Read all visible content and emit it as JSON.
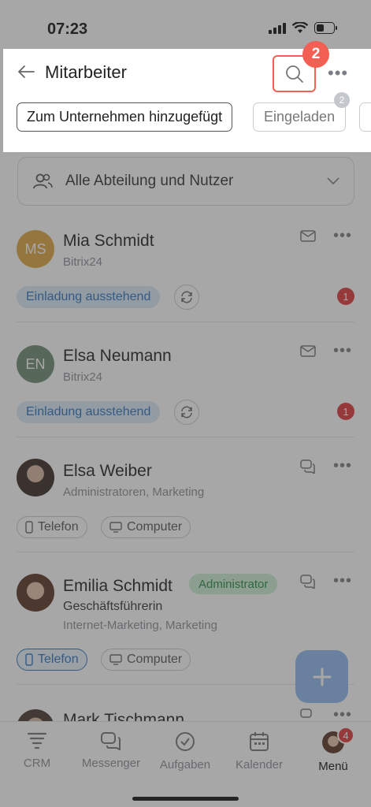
{
  "status": {
    "time": "07:23"
  },
  "header": {
    "title": "Mitarbeiter",
    "step_number": "2",
    "filters": [
      {
        "label": "Zum Unternehmen hinzugefügt"
      },
      {
        "label": "Eingeladen",
        "count": "2"
      }
    ]
  },
  "department_select": {
    "label": "Alle Abteilung und Nutzer"
  },
  "employees": [
    {
      "initials": "MS",
      "name": "Mia Schmidt",
      "company": "Bitrix24",
      "status": "Einladung ausstehend",
      "unread": "1",
      "avatar_color": "#e0a743"
    },
    {
      "initials": "EN",
      "name": "Elsa Neumann",
      "company": "Bitrix24",
      "status": "Einladung ausstehend",
      "unread": "1",
      "avatar_color": "#6d8a73"
    },
    {
      "name": "Elsa Weiber",
      "departments": "Administratoren, Marketing",
      "devices": [
        "Telefon",
        "Computer"
      ]
    },
    {
      "name": "Emilia Schmidt",
      "badge": "Administrator",
      "position": "Geschäftsführerin",
      "departments": "Internet-Marketing, Marketing",
      "devices": [
        "Telefon",
        "Computer"
      ]
    },
    {
      "name": "Mark Tischmann"
    }
  ],
  "tabbar": {
    "tabs": [
      {
        "label": "CRM",
        "icon": "crm-icon"
      },
      {
        "label": "Messenger",
        "icon": "messenger-icon"
      },
      {
        "label": "Aufgaben",
        "icon": "tasks-icon"
      },
      {
        "label": "Kalender",
        "icon": "calendar-icon"
      },
      {
        "label": "Menü",
        "icon": "menu-avatar",
        "badge": "4"
      }
    ],
    "active": "Menü"
  },
  "colors": {
    "accent": "#2f74c0",
    "highlight": "#f35f52",
    "badge_red": "#e0383a"
  }
}
